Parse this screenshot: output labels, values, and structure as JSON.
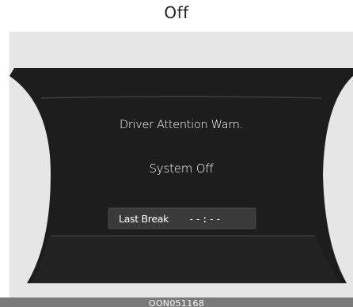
{
  "caption": "Off",
  "display": {
    "title": "Driver Attention Warn.",
    "status": "System Off",
    "last_break": {
      "label": "Last Break",
      "value": "--:--"
    }
  },
  "figure_code": "OON051168",
  "colors": {
    "screen_background": "#1c1c1c",
    "figure_background": "#e6e6e6",
    "text": "#ffffff",
    "footer_bar": "#7a7a7a"
  }
}
